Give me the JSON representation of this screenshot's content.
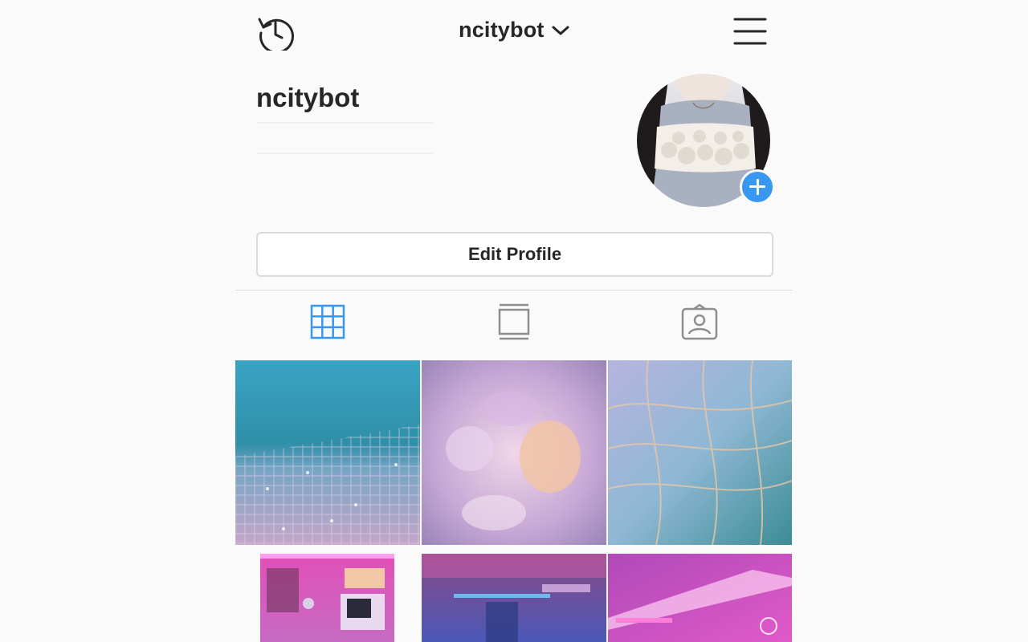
{
  "header": {
    "username": "ncitybot",
    "history_icon": "history-icon",
    "dropdown_icon": "chevron-down-icon",
    "menu_icon": "hamburger-menu-icon"
  },
  "profile": {
    "name": "ncitybot",
    "edit_button_label": "Edit Profile",
    "add_story_icon": "plus-icon"
  },
  "tabs": [
    {
      "name": "grid",
      "icon": "grid-icon",
      "active": true
    },
    {
      "name": "feed",
      "icon": "feed-icon",
      "active": false
    },
    {
      "name": "tagged",
      "icon": "tagged-icon",
      "active": false
    }
  ],
  "colors": {
    "accent": "#3897f0",
    "text": "#262626",
    "inactive_icon": "#8e8e8e",
    "border": "#dbdbdb",
    "background": "#fafafa"
  },
  "posts": [
    {
      "description": "holographic pool tiles"
    },
    {
      "description": "iridescent seashells"
    },
    {
      "description": "shimmering water tiles"
    },
    {
      "description": "neon pink bedroom"
    },
    {
      "description": "neon purple hallway"
    },
    {
      "description": "neon pink room"
    }
  ]
}
